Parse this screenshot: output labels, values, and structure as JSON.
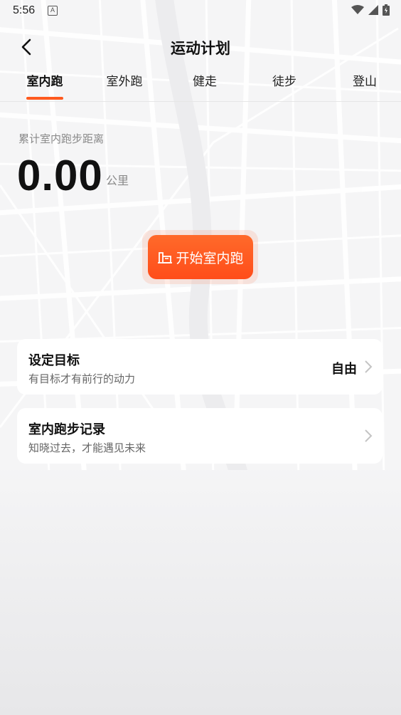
{
  "status_bar": {
    "time": "5:56",
    "notification_icon": "A"
  },
  "nav": {
    "title": "运动计划"
  },
  "tabs": [
    {
      "label": "室内跑",
      "active": true
    },
    {
      "label": "室外跑",
      "active": false
    },
    {
      "label": "健走",
      "active": false
    },
    {
      "label": "徒步",
      "active": false
    },
    {
      "label": "登山",
      "active": false
    }
  ],
  "summary": {
    "label": "累计室内跑步距离",
    "value": "0.00",
    "unit": "公里"
  },
  "start_button": {
    "label": "开始室内跑",
    "icon": "treadmill-icon"
  },
  "goal_card": {
    "title": "设定目标",
    "subtitle": "有目标才有前行的动力",
    "value": "自由"
  },
  "record_card": {
    "title": "室内跑步记录",
    "subtitle": "知晓过去，才能遇见未来"
  },
  "colors": {
    "accent": "#ff5a1f",
    "text": "#111111",
    "muted": "#8a8a8a"
  }
}
